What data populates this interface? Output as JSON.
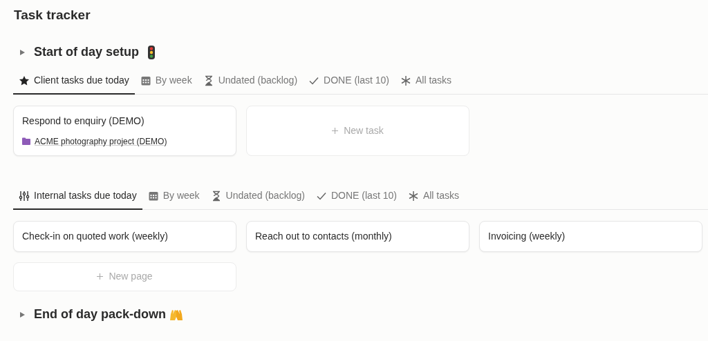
{
  "title": "Task tracker",
  "blocks": [
    {
      "kind": "toggle",
      "title": "Start of day setup",
      "expanded": false
    },
    {
      "kind": "view",
      "tabs": [
        {
          "label": "Client tasks due today",
          "selected": true
        },
        {
          "label": "By week",
          "selected": false
        },
        {
          "label": "Undated (backlog)",
          "selected": false
        },
        {
          "label": "DONE (last 10)",
          "selected": false
        },
        {
          "label": "All tasks",
          "selected": false
        }
      ],
      "cards": [
        {
          "kind": "task",
          "title": "Respond to enquiry (DEMO)",
          "project": "ACME photography project (DEMO)"
        },
        {
          "kind": "new",
          "label": "New task"
        }
      ]
    },
    {
      "kind": "view",
      "tabs": [
        {
          "label": "Internal tasks due today",
          "selected": true
        },
        {
          "label": "By week",
          "selected": false
        },
        {
          "label": "Undated (backlog)",
          "selected": false
        },
        {
          "label": "DONE (last 10)",
          "selected": false
        },
        {
          "label": "All tasks",
          "selected": false
        }
      ],
      "cards": [
        {
          "kind": "task",
          "title": "Check-in on quoted work (weekly)"
        },
        {
          "kind": "task",
          "title": "Reach out to contacts (monthly)"
        },
        {
          "kind": "task",
          "title": "Invoicing (weekly)"
        },
        {
          "kind": "new",
          "label": "New page"
        }
      ]
    },
    {
      "kind": "toggle",
      "title": "End of day pack-down",
      "expanded": false
    }
  ]
}
